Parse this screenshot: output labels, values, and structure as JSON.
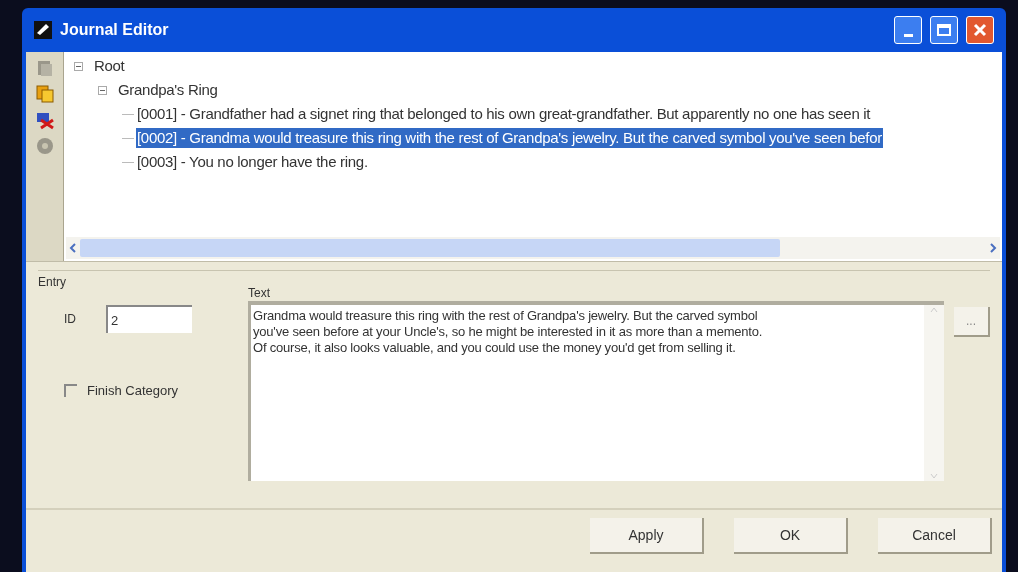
{
  "window": {
    "title": "Journal Editor"
  },
  "tree": [
    {
      "label": "Root",
      "expanded": true,
      "children": [
        {
          "label": "Grandpa's Ring",
          "expanded": true,
          "children": [
            {
              "label": "[0001] - Grandfather had a signet ring that belonged to his own great-grandfather. But apparently no one has seen it",
              "selected": false
            },
            {
              "label": "[0002] - Grandma would treasure this ring with the rest of Grandpa's jewelry. But the carved symbol you've seen befor",
              "selected": true
            },
            {
              "label": "[0003] - You no longer have the ring.",
              "selected": false
            }
          ]
        }
      ]
    }
  ],
  "entry": {
    "title": "Entry",
    "id_label": "ID",
    "id_value": "2",
    "finish_category": {
      "label": "Finish Category",
      "checked": false
    },
    "text_label": "Text",
    "text_value": "Grandma would treasure this ring with the rest of Grandpa's jewelry. But the carved symbol\nyou've seen before at your Uncle's, so he might be interested in it as more than a memento.\nOf course, it also looks valuable, and you could use the money you'd get from selling it.",
    "browse_button": "..."
  },
  "buttons": [
    "Apply",
    "OK",
    "Cancel"
  ]
}
